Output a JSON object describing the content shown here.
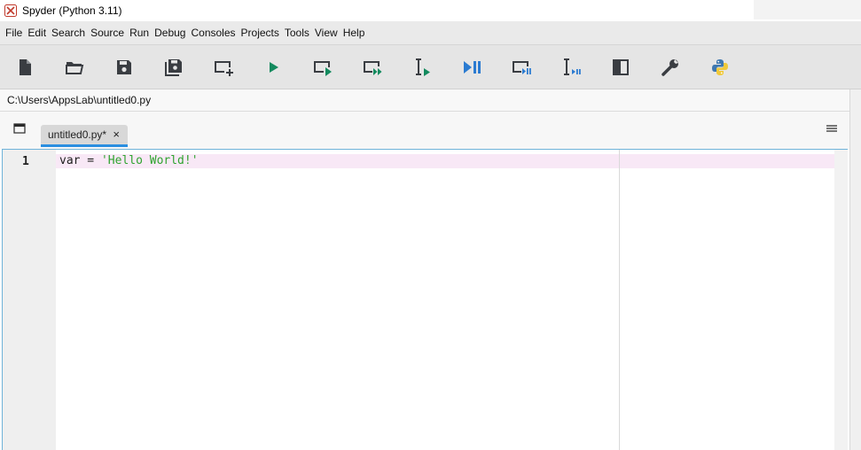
{
  "window": {
    "title": "Spyder (Python 3.11)"
  },
  "menubar": {
    "items": [
      "File",
      "Edit",
      "Search",
      "Source",
      "Run",
      "Debug",
      "Consoles",
      "Projects",
      "Tools",
      "View",
      "Help"
    ]
  },
  "toolbar": {
    "buttons": [
      {
        "icon": "new-file-icon"
      },
      {
        "icon": "open-file-icon"
      },
      {
        "icon": "save-icon"
      },
      {
        "icon": "save-all-icon"
      },
      {
        "icon": "create-cell-icon"
      },
      {
        "icon": "run-file-icon"
      },
      {
        "icon": "run-cell-icon"
      },
      {
        "icon": "run-cell-advance-icon"
      },
      {
        "icon": "run-selection-icon"
      },
      {
        "icon": "debug-file-icon"
      },
      {
        "icon": "debug-cell-icon"
      },
      {
        "icon": "debug-selection-icon"
      },
      {
        "icon": "maximize-pane-icon"
      },
      {
        "icon": "preferences-wrench-icon"
      },
      {
        "icon": "python-path-manager-icon"
      }
    ],
    "colors": {
      "icon": "#3a3d42",
      "run": "#138a5e",
      "debug": "#2b7bd1",
      "python_blue": "#3f78b0",
      "python_yellow": "#f0c93a"
    }
  },
  "pathbar": {
    "path": "C:\\Users\\AppsLab\\untitled0.py"
  },
  "editor": {
    "tabs": [
      {
        "label": "untitled0.py*",
        "close": "×"
      }
    ],
    "lines": [
      {
        "number": "1",
        "tokens": [
          {
            "text": "var",
            "kind": "name"
          },
          {
            "text": " = ",
            "kind": "op"
          },
          {
            "text": "'Hello World!'",
            "kind": "str"
          }
        ]
      }
    ],
    "colors": {
      "current_line": "#f8e8f6",
      "string": "#2fa32f",
      "tab_accent": "#2a8ee0"
    }
  }
}
